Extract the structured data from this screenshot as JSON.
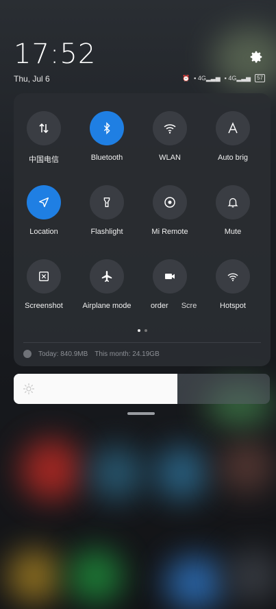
{
  "status": {
    "time": "17:52",
    "date": "Thu, Jul 6",
    "battery": "57"
  },
  "tiles": [
    {
      "label": "中国电信",
      "icon": "mobile-data-icon",
      "active": false
    },
    {
      "label": "Bluetooth",
      "icon": "bluetooth-icon",
      "active": true
    },
    {
      "label": "WLAN",
      "icon": "wifi-icon",
      "active": false
    },
    {
      "label": "Auto brig",
      "icon": "auto-brightness-icon",
      "active": false
    },
    {
      "label": "Location",
      "icon": "location-icon",
      "active": true
    },
    {
      "label": "Flashlight",
      "icon": "flashlight-icon",
      "active": false
    },
    {
      "label": "Mi Remote",
      "icon": "remote-icon",
      "active": false
    },
    {
      "label": "Mute",
      "icon": "bell-icon",
      "active": false
    },
    {
      "label": "Screenshot",
      "icon": "screenshot-icon",
      "active": false
    },
    {
      "label": "Airplane mode",
      "icon": "airplane-icon",
      "active": false
    },
    {
      "label": "order",
      "icon": "video-recorder-icon",
      "active": false
    },
    {
      "label": "Scre",
      "icon": "screen-icon",
      "active": false
    },
    {
      "label": "Hotspot",
      "icon": "hotspot-icon",
      "active": false
    }
  ],
  "usage": {
    "today": "Today: 840.9MB",
    "month": "This month: 24.19GB"
  },
  "brightness": {
    "level": 0.64
  },
  "colors": {
    "accent": "#1f7fe3",
    "tile_off": "#3a3d43",
    "panel": "#2a2d32"
  }
}
